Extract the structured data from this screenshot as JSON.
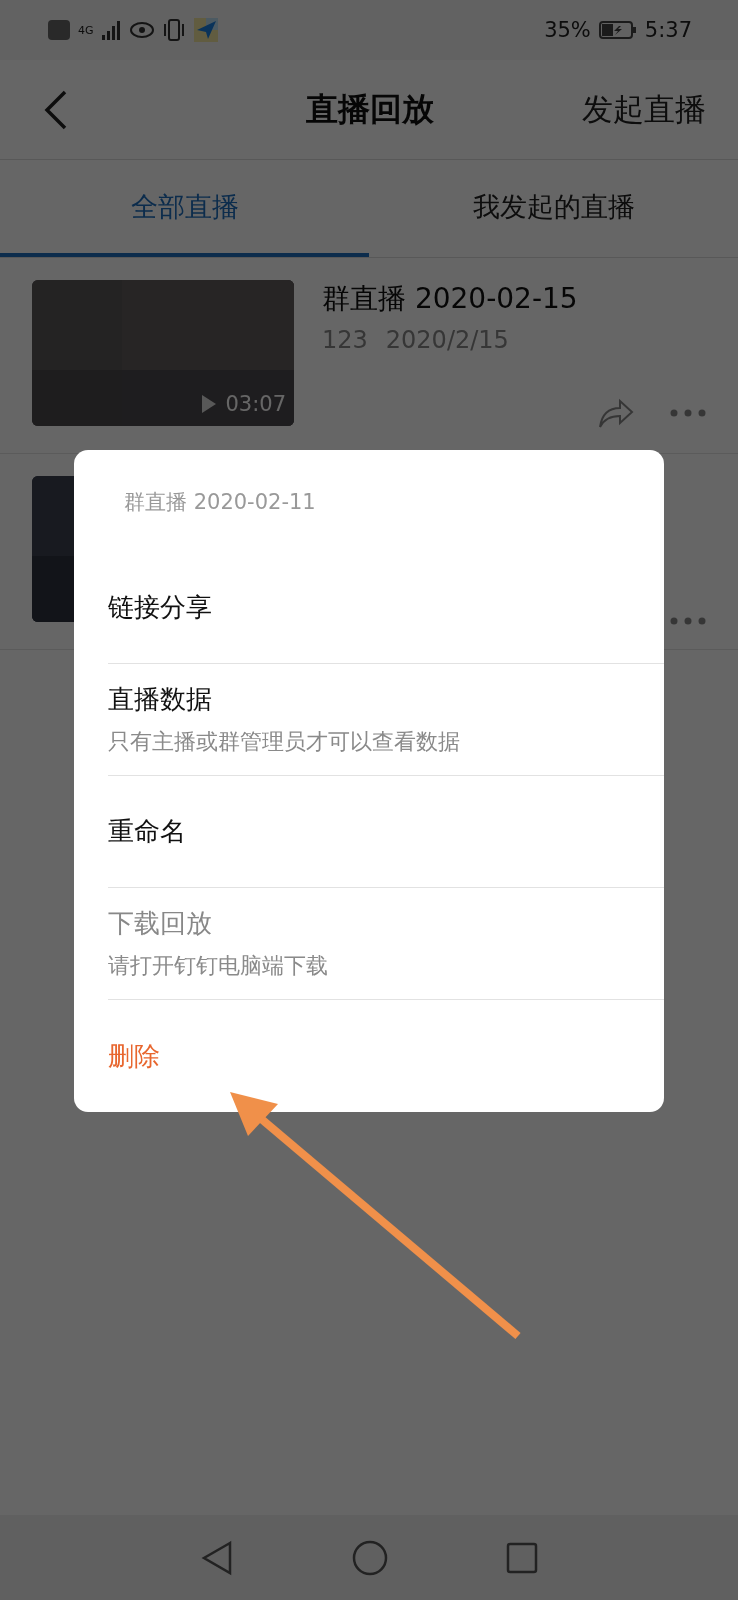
{
  "status_bar": {
    "network": "4G",
    "battery_percent": "35%",
    "time": "5:37"
  },
  "header": {
    "title": "直播回放",
    "action": "发起直播"
  },
  "tabs": [
    {
      "label": "全部直播",
      "selected": true
    },
    {
      "label": "我发起的直播",
      "selected": false
    }
  ],
  "recordings": [
    {
      "kind": "full",
      "title": "群直播 2020-02-15",
      "author": "123",
      "date": "2020/2/15",
      "duration": "03:07"
    },
    {
      "kind": "covered"
    }
  ],
  "dialog": {
    "title": "群直播 2020-02-11",
    "options": [
      {
        "kind": "normal",
        "label": "链接分享"
      },
      {
        "kind": "normal",
        "label": "直播数据",
        "hint": "只有主播或群管理员才可以查看数据"
      },
      {
        "kind": "normal",
        "label": "重命名"
      },
      {
        "kind": "disabled",
        "label": "下载回放",
        "hint": "请打开钉钉电脑端下载"
      },
      {
        "kind": "danger",
        "label": "删除"
      }
    ]
  }
}
